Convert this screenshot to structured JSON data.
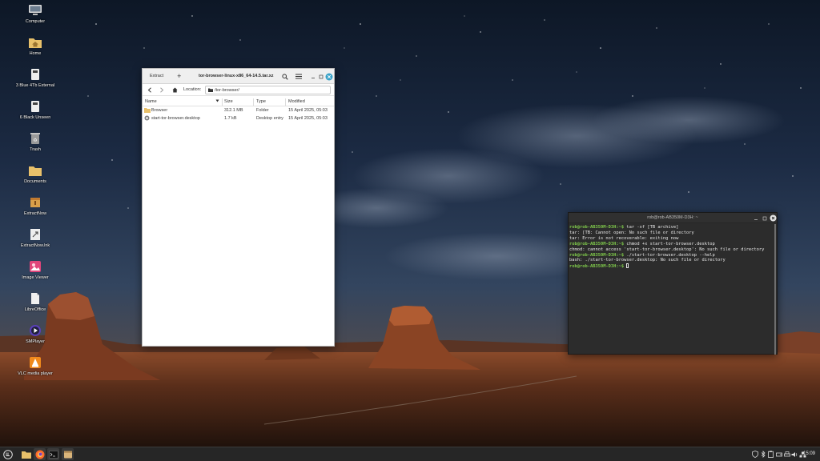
{
  "desktop": {
    "icons": [
      {
        "label": "Computer",
        "icon": "computer-icon"
      },
      {
        "label": "Home",
        "icon": "home-folder-icon"
      },
      {
        "label": "3 Blue 4Tb External",
        "icon": "drive-icon"
      },
      {
        "label": "6 Black Unseen",
        "icon": "drive-icon"
      },
      {
        "label": "Trash",
        "icon": "trash-icon"
      },
      {
        "label": "Documents",
        "icon": "folder-icon"
      },
      {
        "label": "ExtractNow",
        "icon": "archive-icon"
      },
      {
        "label": "ExtractNow.lnk",
        "icon": "shortcut-icon"
      },
      {
        "label": "Image Viewer",
        "icon": "image-viewer-icon"
      },
      {
        "label": "LibreOffice",
        "icon": "libreoffice-icon"
      },
      {
        "label": "SMPlayer",
        "icon": "smplayer-icon"
      },
      {
        "label": "VLC media player",
        "icon": "vlc-icon"
      }
    ]
  },
  "file_roller": {
    "extract_label": "Extract",
    "add_label": "+",
    "title": "tor-browser-linux-x86_64-14.5.tar.xz",
    "location_label": "Location:",
    "location_value": "/tor-browser/",
    "columns": {
      "name": "Name",
      "size": "Size",
      "type": "Type",
      "modified": "Modified"
    },
    "rows": [
      {
        "name": "Browser",
        "size": "312.1 MB",
        "type": "Folder",
        "modified": "15 April 2025, 05:03",
        "icon": "folder-icon"
      },
      {
        "name": "start-tor-browser.desktop",
        "size": "1.7 kB",
        "type": "Desktop entry",
        "modified": "15 April 2025, 05:03",
        "icon": "desktop-entry-icon"
      }
    ]
  },
  "terminal": {
    "title": "rob@rob-AB350M-D3H: ~",
    "lines": [
      {
        "prompt": "rob@rob-AB350M-D3H:~$",
        "text": " tar -xf [TB archive]"
      },
      {
        "prompt": "",
        "text": "tar: [TB: Cannot open: No such file or directory"
      },
      {
        "prompt": "",
        "text": "tar: Error is not recoverable: exiting now"
      },
      {
        "prompt": "rob@rob-AB350M-D3H:~$",
        "text": " chmod +x start-tor-browser.desktop"
      },
      {
        "prompt": "",
        "text": "chmod: cannot access 'start-tor-browser.desktop': No such file or directory"
      },
      {
        "prompt": "rob@rob-AB350M-D3H:~$",
        "text": " ./start-tor-browser.desktop --help"
      },
      {
        "prompt": "",
        "text": "bash: ./start-tor-browser.desktop: No such file or directory"
      },
      {
        "prompt": "rob@rob-AB350M-D3H:~$",
        "text": " "
      }
    ]
  },
  "panel": {
    "clock": "15:09",
    "launchers": [
      "menu-icon",
      "firefox-icon",
      "files-icon",
      "terminal-icon",
      "file-roller-icon"
    ],
    "tray": [
      "shield-icon",
      "bluetooth-icon",
      "clipboard-icon",
      "drive-icon",
      "printer-icon",
      "update-icon",
      "network-icon",
      "volume-icon",
      "battery-icon"
    ]
  },
  "colors": {
    "prompt_green": "#7ec84a",
    "panel_bg": "#262626",
    "terminal_bg": "#2c2c2c",
    "folder_yellow": "#e8c06a"
  }
}
